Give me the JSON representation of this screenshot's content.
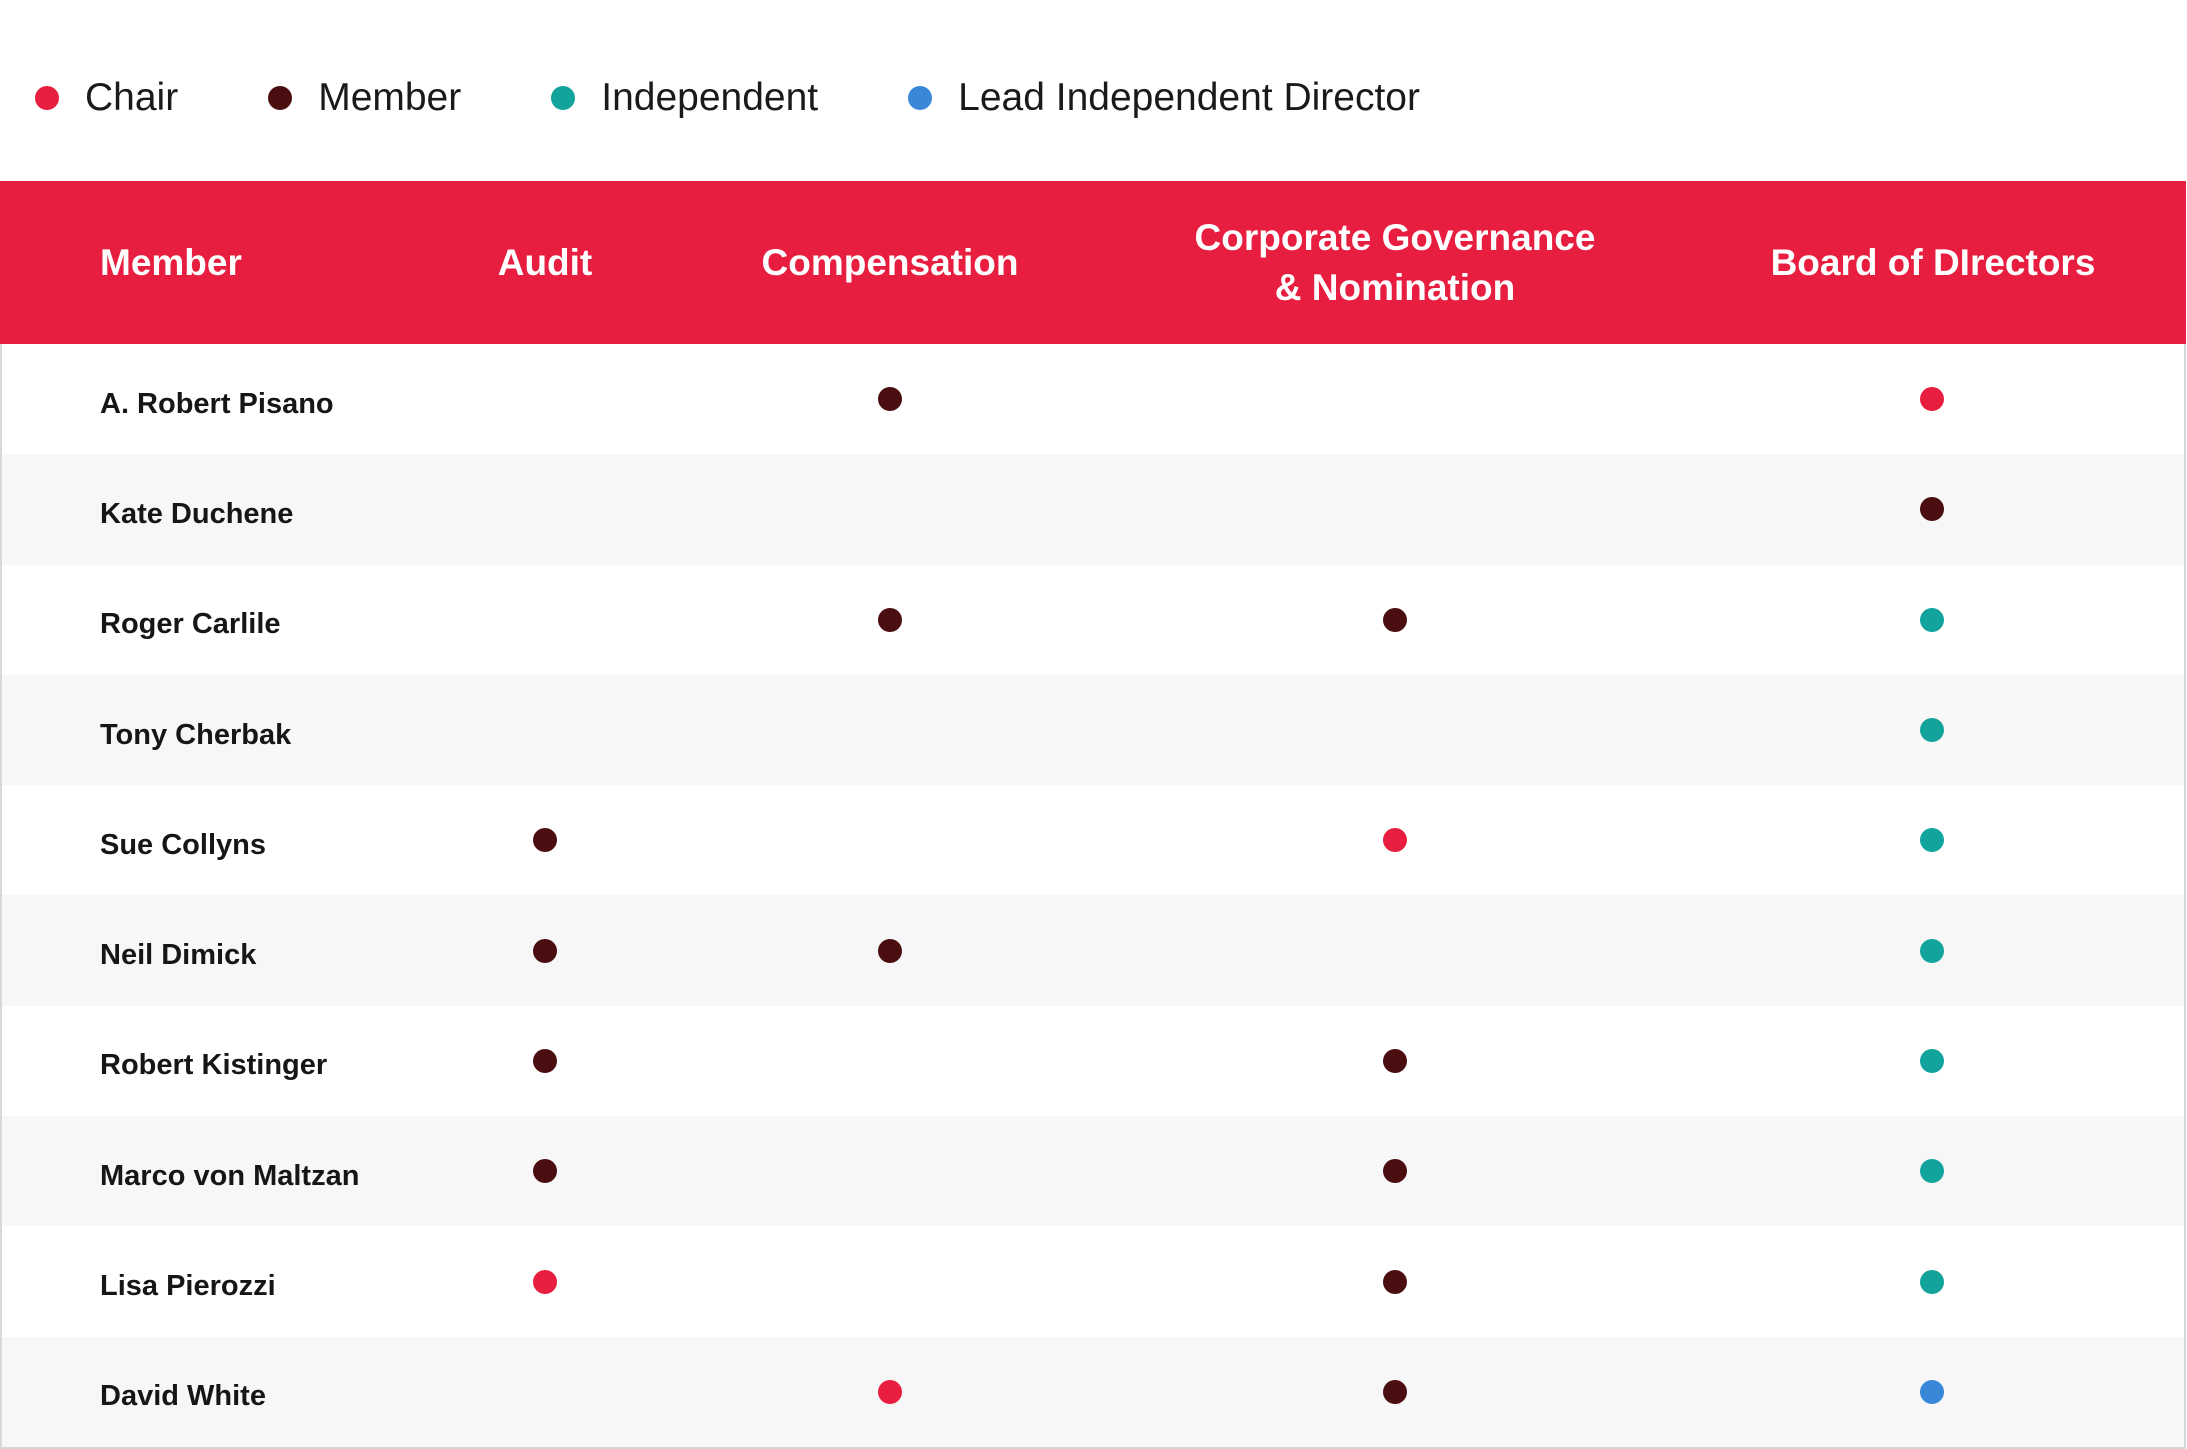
{
  "colors": {
    "header_bg": "#E81E40",
    "chair": "#E81E40",
    "member": "#4A0E10",
    "independent": "#12A39D",
    "lead_independent_director": "#3A86D8"
  },
  "legend": [
    {
      "key": "chair",
      "label": "Chair"
    },
    {
      "key": "member",
      "label": "Member"
    },
    {
      "key": "independent",
      "label": "Independent"
    },
    {
      "key": "lead_independent_director",
      "label": "Lead Independent Director"
    }
  ],
  "table": {
    "columns": [
      "Member",
      "Audit",
      "Compensation",
      "Corporate Governance & Nomination",
      "Board of DIrectors"
    ],
    "header_lines": {
      "member": "Member",
      "audit": "Audit",
      "compensation": "Compensation",
      "governance_line1": "Corporate Governance",
      "governance_line2": "& Nomination",
      "board": "Board of DIrectors"
    },
    "rows": [
      {
        "name": "A. Robert Pisano",
        "audit": null,
        "compensation": "member",
        "governance": null,
        "board": "chair"
      },
      {
        "name": "Kate Duchene",
        "audit": null,
        "compensation": null,
        "governance": null,
        "board": "member"
      },
      {
        "name": "Roger Carlile",
        "audit": null,
        "compensation": "member",
        "governance": "member",
        "board": "independent"
      },
      {
        "name": "Tony Cherbak",
        "audit": null,
        "compensation": null,
        "governance": null,
        "board": "independent"
      },
      {
        "name": "Sue Collyns",
        "audit": "member",
        "compensation": null,
        "governance": "chair",
        "board": "independent"
      },
      {
        "name": "Neil Dimick",
        "audit": "member",
        "compensation": "member",
        "governance": null,
        "board": "independent"
      },
      {
        "name": "Robert Kistinger",
        "audit": "member",
        "compensation": null,
        "governance": "member",
        "board": "independent"
      },
      {
        "name": "Marco von Maltzan",
        "audit": "member",
        "compensation": null,
        "governance": "member",
        "board": "independent"
      },
      {
        "name": "Lisa Pierozzi",
        "audit": "chair",
        "compensation": null,
        "governance": "member",
        "board": "independent"
      },
      {
        "name": "David White",
        "audit": null,
        "compensation": "chair",
        "governance": "member",
        "board": "lead_independent_director"
      }
    ]
  }
}
